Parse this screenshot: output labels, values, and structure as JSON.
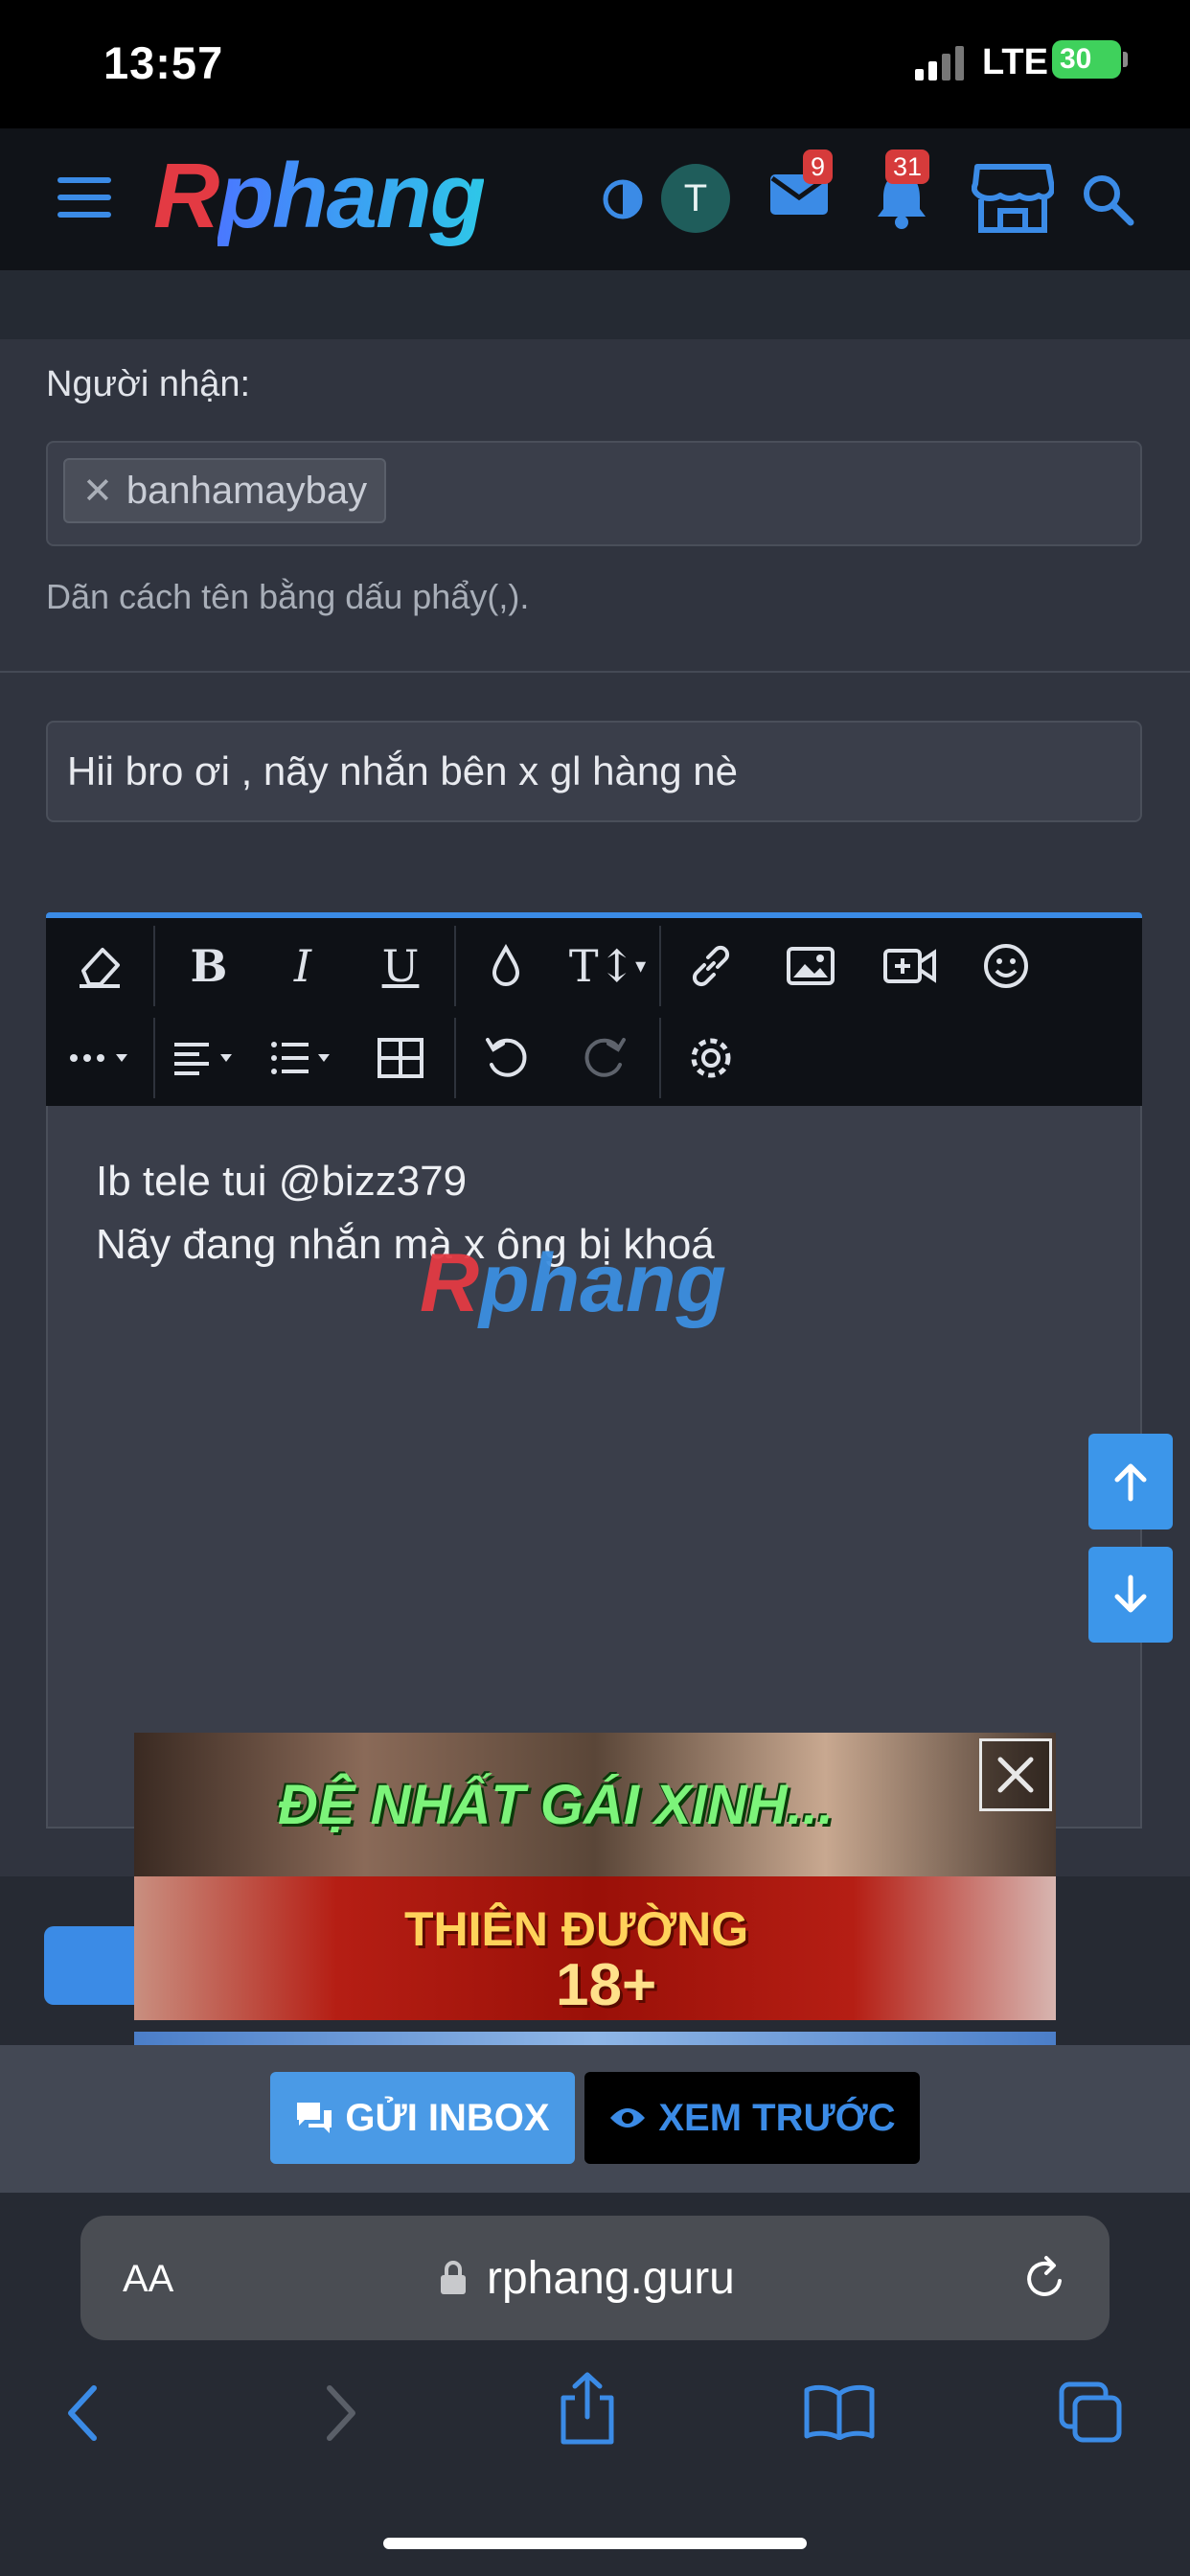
{
  "status_bar": {
    "time": "13:57",
    "network": "LTE",
    "battery": "30"
  },
  "header": {
    "logo": {
      "first": "R",
      "rest": "phang"
    },
    "avatar_letter": "T",
    "messages_badge": "9",
    "alerts_badge": "31"
  },
  "form": {
    "recipients_label": "Người nhận:",
    "recipient_tag": "banhamaybay",
    "recipients_hint": "Dãn cách tên bằng dấu phẩy(,).",
    "title_value": "Hii bro ơi , nãy nhắn bên x gl hàng nè",
    "message_lines": [
      "Ib tele tui @bizz379",
      "Nãy đang nhắn mà x ông bị khoá"
    ]
  },
  "editor_toolbar": {
    "row1": [
      "eraser-icon",
      "bold-icon",
      "italic-icon",
      "underline-icon",
      "color-drop-icon",
      "text-size-icon",
      "link-icon",
      "image-icon",
      "video-icon",
      "emoji-icon"
    ],
    "row2": [
      "more-icon",
      "align-icon",
      "list-icon",
      "table-icon",
      "undo-icon",
      "redo-icon",
      "settings-icon"
    ]
  },
  "ad": {
    "line1": "ĐỆ NHẤT GÁI XINH...",
    "line2": "THIÊN ĐƯỜNG",
    "line3": "18+"
  },
  "actions": {
    "send": "GỬI INBOX",
    "preview": "XEM TRƯỚC"
  },
  "browser": {
    "text_size": "AA",
    "url": "rphang.guru"
  },
  "colors": {
    "accent": "#3b8be6",
    "header_bg": "#101318",
    "page_bg": "#30343f"
  }
}
